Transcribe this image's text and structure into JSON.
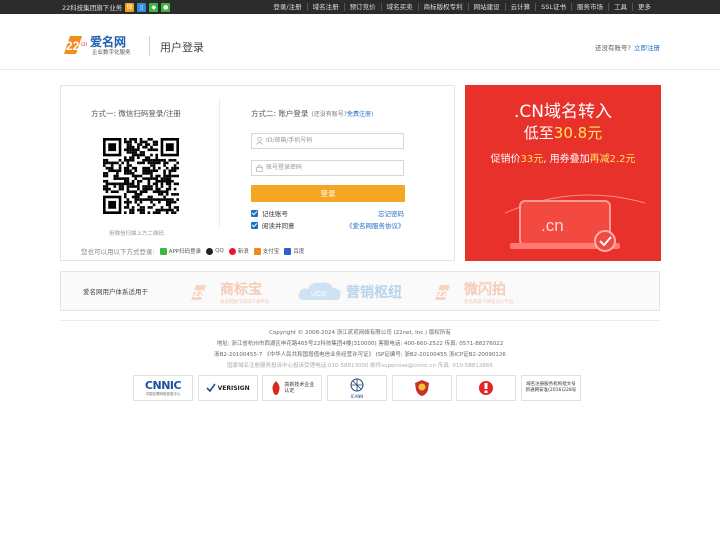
{
  "topbar": {
    "group_text": "22科技集团旗下业务",
    "nav": [
      "登录/注册",
      "域名注册",
      "预订竞价",
      "域名买卖",
      "商标版权专利",
      "网站建设",
      "云计算",
      "SSL证书",
      "服务市场",
      "工具",
      "更多"
    ]
  },
  "header": {
    "logo_text": "爱名网",
    "logo_sub": "企业数字化服务",
    "title": "用户登录",
    "no_account": "还没有账号?",
    "register_link": "立即注册"
  },
  "login": {
    "method1": "方式一: 微信扫码登录/注册",
    "qr_caption": "用微信扫描上方二维码",
    "method2": "方式二: 账户登录",
    "method2_hint": "(还没有账号?",
    "method2_link": "免费注册",
    "method2_close": ")",
    "id_placeholder": "ID/邮箱/手机号码",
    "pwd_placeholder": "账号登录密码",
    "login_button": "登录",
    "remember": "记住账号",
    "forgot": "忘记密码",
    "agree": "阅读并同意",
    "agreement": "《爱名网服务协议》",
    "other_label": "您也可以用以下方式登录:",
    "other_options": [
      "APP扫码登录",
      "QQ",
      "新浪",
      "支付宝",
      "百度"
    ]
  },
  "banner": {
    "line1": ".CN域名转入",
    "line2_pre": "低至",
    "line2_price": "30.8元",
    "line3_pre": "促销价",
    "line3_price": "33元",
    "line3_mid": ", 用券叠加",
    "line3_disc": "再减2.2元",
    "tag": ".cn"
  },
  "suite": {
    "label": "爱名网用户体系适用于",
    "products": [
      "商标宝",
      "营销枢纽",
      "微闪拍"
    ],
    "product_sub": [
      "爱名网旗下知识产权平台",
      "",
      "爱名网旗下域名竞价平台"
    ]
  },
  "footer": {
    "copyright": "Copyright ©   2008-2024 浙江贰贰网络有限公司 (22net, Inc.) 版权所有",
    "address": "地址: 浙江省杭州市西湖区申花路465号22科技集团4楼(310000)  客服电话: 400-660-2522  传真: 0571-88276022",
    "licenses": "浙B2-20100455-7  《中华人民共和国增值电信业务经营许可证》  ISP证编号: 浙B2-20100455  浙ICP证B2-20090126",
    "report": "国家域名注册服务投诉中心投诉受理电话:010-58813000  邮件supervise@cnnic.cn  传真: 010-58812666"
  },
  "badges": [
    "CNNIC",
    "VERISIGN",
    "高新技术企业认定",
    "ICANN",
    "",
    "",
    "域名注册服务机构批文号 新通网安准(2016)228号"
  ],
  "badge_sub": {
    "cnnic": "中国互联网络信息中心"
  },
  "colors": {
    "accent": "#1f6fc5",
    "button": "#f5a623",
    "banner": "#e8312a",
    "highlight": "#ffe45c"
  }
}
